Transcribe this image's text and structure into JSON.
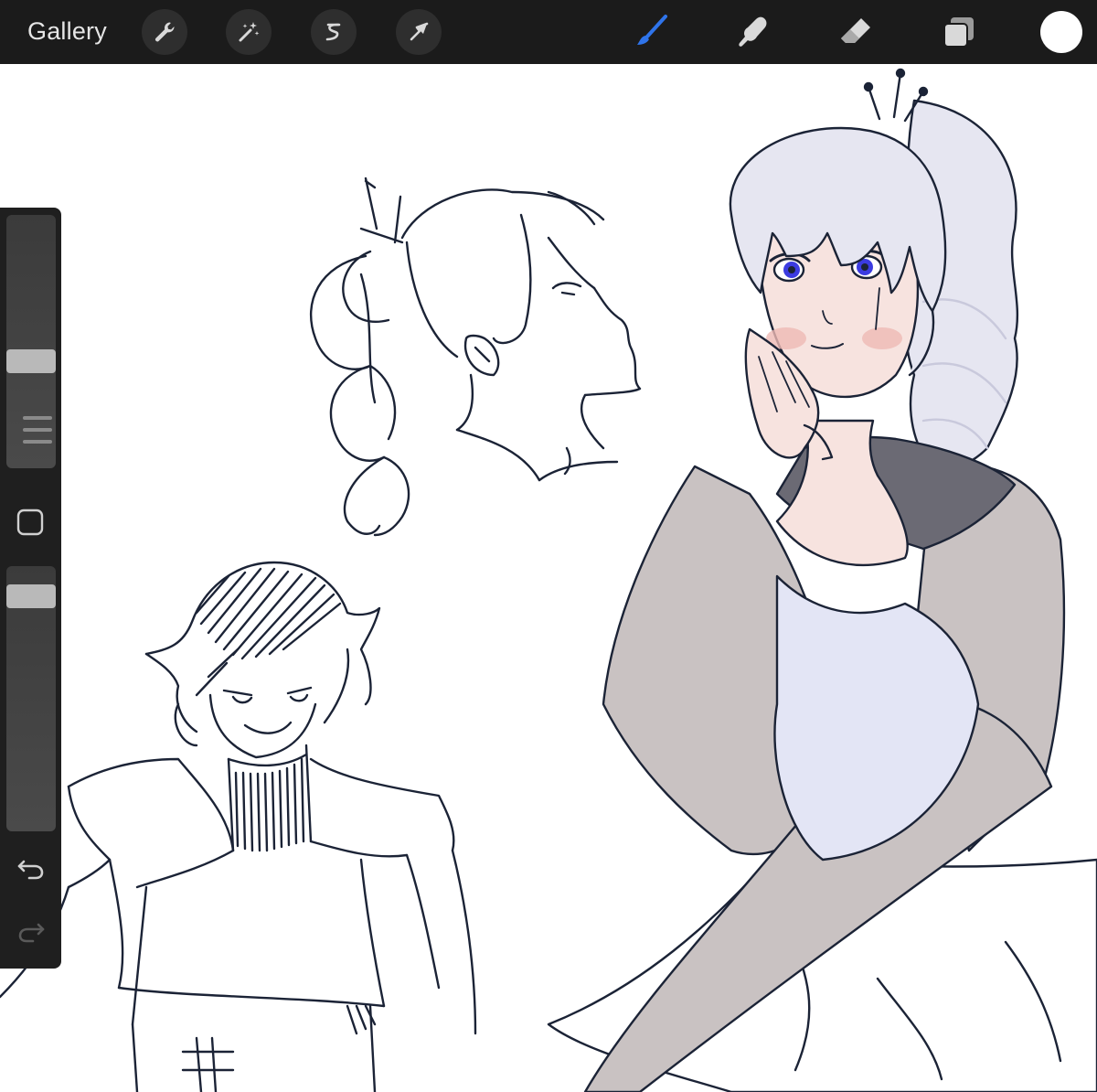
{
  "toolbar": {
    "gallery_label": "Gallery",
    "left_tools": [
      {
        "name": "actions",
        "icon": "wrench-icon"
      },
      {
        "name": "adjustments",
        "icon": "magic-wand-icon"
      },
      {
        "name": "selection",
        "icon": "selection-s-icon"
      },
      {
        "name": "transform",
        "icon": "arrow-cursor-icon"
      }
    ],
    "right_tools": [
      {
        "name": "brush",
        "icon": "brush-icon",
        "active": true,
        "color": "#2f74ea"
      },
      {
        "name": "smudge",
        "icon": "smudge-finger-icon",
        "active": false
      },
      {
        "name": "eraser",
        "icon": "eraser-icon",
        "active": false
      },
      {
        "name": "layers",
        "icon": "layers-icon",
        "active": false
      }
    ],
    "current_color": "#ffffff"
  },
  "sidebar": {
    "brush_size_level": 0.6,
    "brush_opacity_level": 0.93,
    "modify_icon": "square-icon",
    "undo_icon": "undo-arrow-icon",
    "redo_icon": "redo-arrow-icon",
    "redo_enabled": false
  },
  "canvas": {
    "background": "#ffffff",
    "stroke_color": "#1b2336",
    "palette": {
      "hair": "#e6e6f1",
      "hair_shadow": "#c9c9dc",
      "skin": "#f7e3df",
      "blush": "#eeb9b4",
      "eyes": "#3b3be0",
      "jacket": "#c9c2c2",
      "collar": "#6b6a74",
      "dress": "#e3e5f5"
    }
  }
}
